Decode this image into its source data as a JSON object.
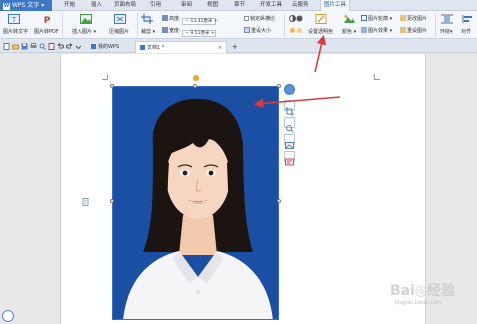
{
  "app": {
    "brand_label": "WPS 文字",
    "logo_letter": "W"
  },
  "menu": {
    "items": [
      "开始",
      "插入",
      "页面布局",
      "引用",
      "审阅",
      "视图",
      "章节",
      "开发工具",
      "云服务",
      "图片工具"
    ]
  },
  "ribbon": {
    "pic_to_text": "图片转文字",
    "pic_to_pdf": "图片转PDF",
    "insert_pic": "插入图片",
    "compress_pic": "压缩图片",
    "crop": "裁剪",
    "rotate": "旋转",
    "height_label": "高度:",
    "height_value": "13.31厘米",
    "width_label": "宽度:",
    "width_value": "9.51厘米",
    "lock_ratio": "锁定纵横比",
    "reset_size": "重设大小",
    "set_transparent": "设置透明色",
    "color": "颜色",
    "pic_outline": "图片轮廓",
    "pic_effect": "图片效果",
    "change_pic": "更改图片",
    "reset_pic": "重设图片",
    "wrap": "环绕",
    "align": "对齐"
  },
  "tabs": {
    "my_wps": "我的WPS",
    "doc1": "文档1 *",
    "close": "×",
    "add": "+"
  },
  "watermark": {
    "text": "Bai◎经验",
    "sub": "jingyan.baidu.com"
  },
  "colors": {
    "photo_background": "#1b4fa3",
    "arrow_red": "#e03a3a",
    "accent": "#3b78c8"
  }
}
